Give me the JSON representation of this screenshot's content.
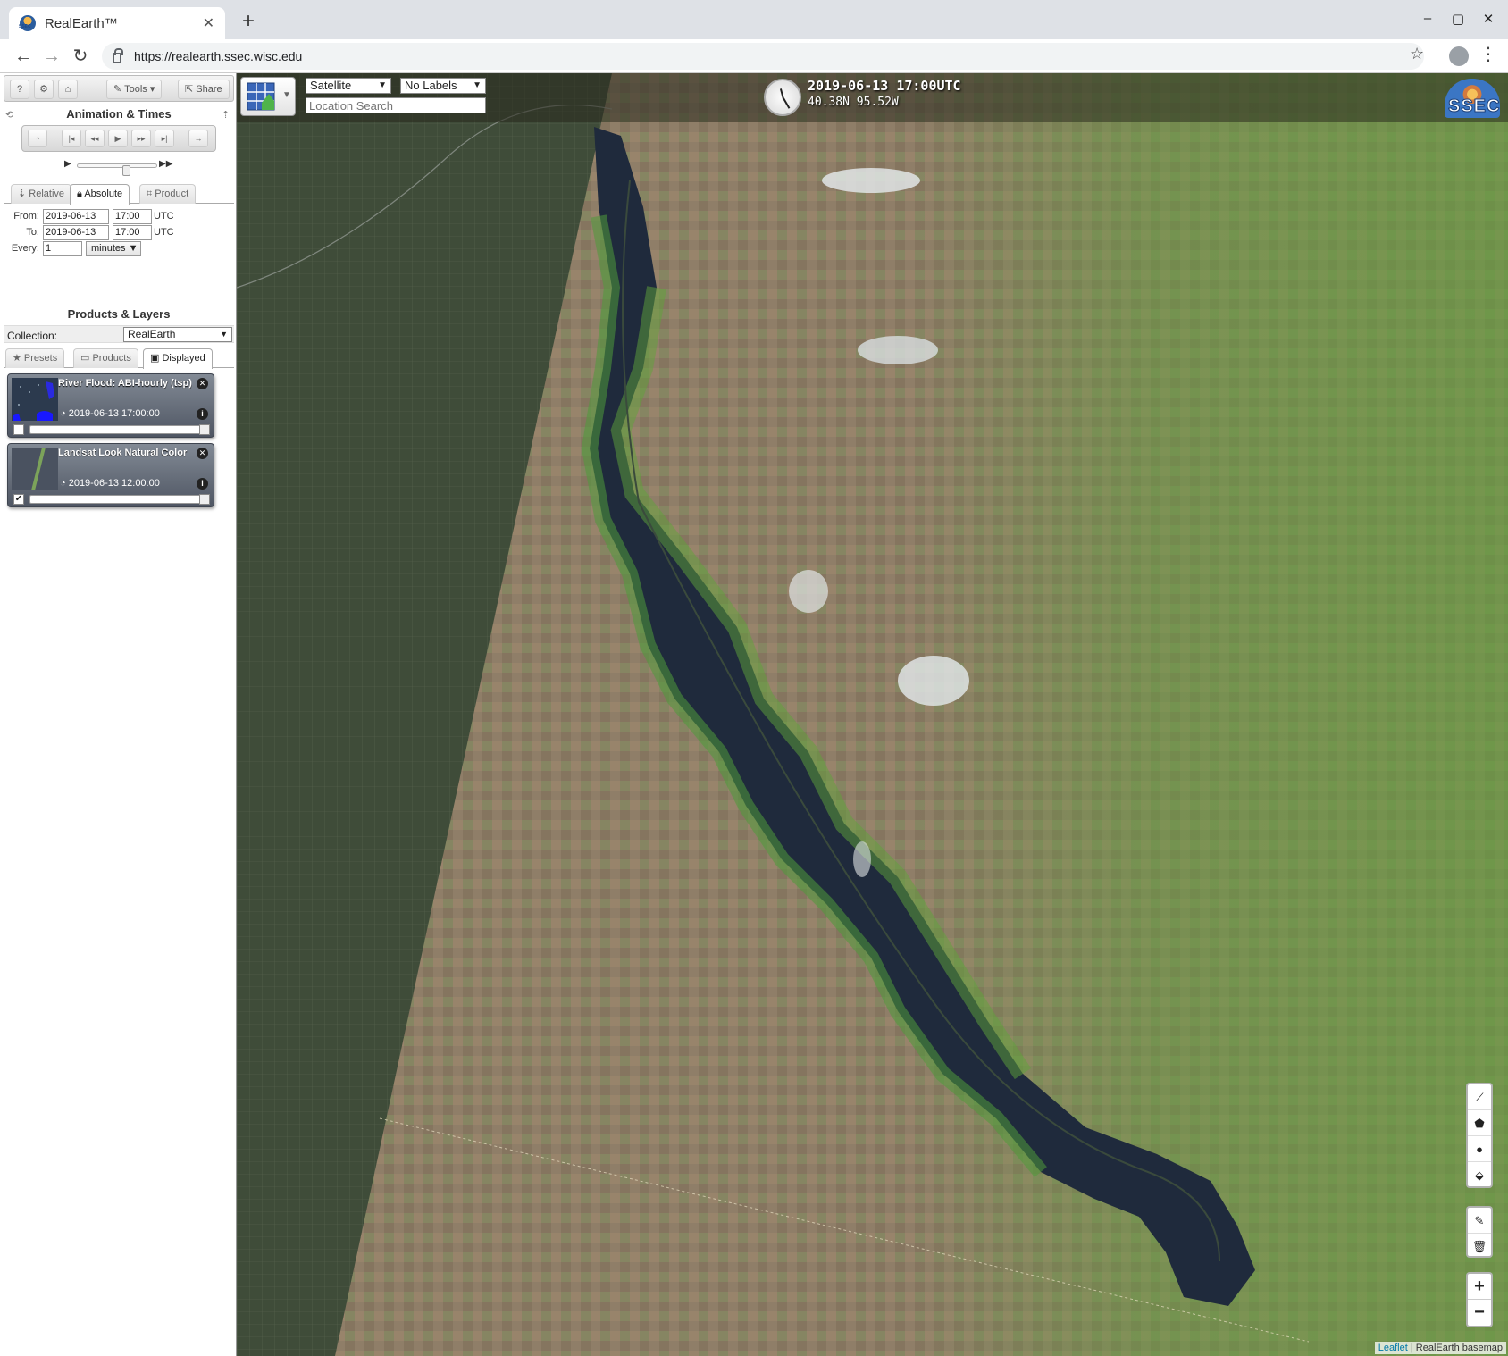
{
  "browser": {
    "tab_title": "RealEarth™",
    "url": "https://realearth.ssec.wisc.edu",
    "new_tab": "+",
    "close_tab": "✕",
    "minimize": "–",
    "maximize": "▢",
    "close_window": "✕"
  },
  "toolbar": {
    "help": "?",
    "settings": "⚙",
    "user": "⌂",
    "tools_label": "Tools ▾",
    "share_label": "Share"
  },
  "animation": {
    "title": "Animation & Times",
    "tabs": [
      "Relative",
      "Absolute",
      "Product"
    ],
    "active_tab": "Absolute",
    "from_label": "From:",
    "from_date": "2019-06-13",
    "from_time": "17:00",
    "to_label": "To:",
    "to_date": "2019-06-13",
    "to_time": "17:00",
    "tz": "UTC",
    "every_label": "Every:",
    "every_value": "1",
    "every_unit": "minutes ▼"
  },
  "products": {
    "title": "Products & Layers",
    "collection_label": "Collection:",
    "collection_value": "RealEarth",
    "tabs": [
      "Presets",
      "Products",
      "Displayed"
    ],
    "active_tab": "Displayed",
    "layers": [
      {
        "name": "River Flood: ABI-hourly (tsp)",
        "time": "2019-06-13 17:00:00",
        "checked": false
      },
      {
        "name": "Landsat Look Natural Color",
        "time": "2019-06-13 12:00:00",
        "checked": true
      }
    ]
  },
  "map": {
    "basemap": "Satellite",
    "labels": "No Labels",
    "search_placeholder": "Location Search",
    "time": "2019-06-13 17:00UTC",
    "coord": "40.38N 95.52W",
    "logo": "SSEC",
    "attribution_link": "Leaflet",
    "attribution_text": " | RealEarth basemap",
    "zoom_in": "+",
    "zoom_out": "−"
  },
  "colors": {
    "water": "#1f2a3c",
    "vegetation": "#5fa33a",
    "farmland": "#8e7d66",
    "forest": "#3d4b36"
  }
}
